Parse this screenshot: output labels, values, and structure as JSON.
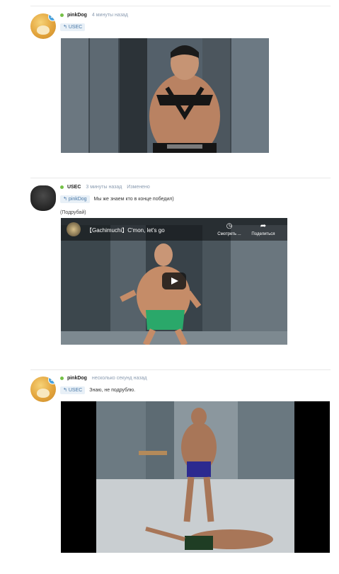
{
  "posts": [
    {
      "username": "pinkDog",
      "time": "4 минуты назад",
      "reply_to": "USEC",
      "reply_text": "",
      "edited": "",
      "extra": ""
    },
    {
      "username": "USEC",
      "time": "3 минуты назад",
      "edited": "Изменено",
      "reply_to": "pinkDog",
      "reply_text": "Мы же знаем кто в конце победил)",
      "extra": "(Подрубай)",
      "video": {
        "title": "【Gachimuchi】C'mon, let's go",
        "watch_later": "Смотреть ...",
        "share": "Поделиться"
      }
    },
    {
      "username": "pinkDog",
      "time": "несколько секунд назад",
      "reply_to": "USEC",
      "reply_text": "Знаю, не подрублю.",
      "edited": "",
      "extra": ""
    }
  ],
  "colors": {
    "online": "#74c046",
    "reply_bg": "#e8f0f7",
    "reply_text": "#4a79a8",
    "meta": "#8a9bb0"
  },
  "icons": {
    "badge": "cloud-badge-icon",
    "reply": "reply-arrow-icon",
    "play": "play-icon",
    "watch_later": "clock-icon",
    "share": "share-icon"
  }
}
